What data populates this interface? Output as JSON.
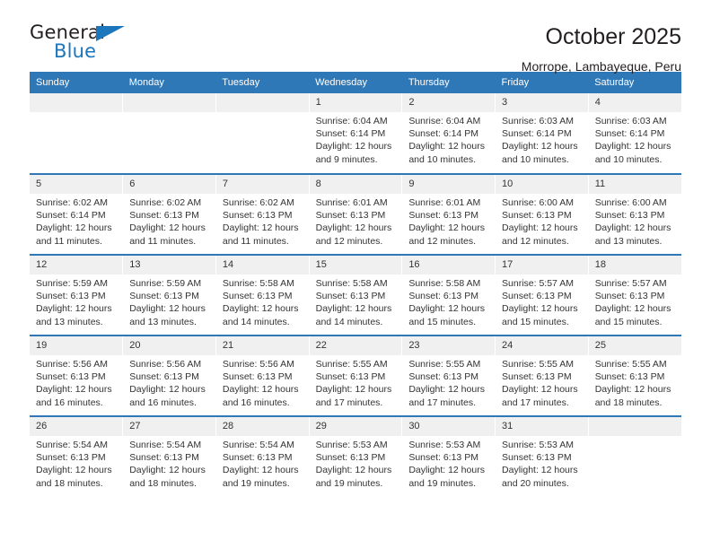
{
  "brand": {
    "name_top": "General",
    "name_bottom": "Blue"
  },
  "header": {
    "title": "October 2025",
    "subtitle": "Morrope, Lambayeque, Peru"
  },
  "colors": {
    "header_blue": "#2e78b8",
    "brand_blue": "#1b76bc",
    "daynum_band": "#f0f0f0",
    "text": "#333333"
  },
  "weekday_headers": [
    "Sunday",
    "Monday",
    "Tuesday",
    "Wednesday",
    "Thursday",
    "Friday",
    "Saturday"
  ],
  "labels": {
    "sunrise": "Sunrise:",
    "sunset": "Sunset:",
    "daylight": "Daylight:"
  },
  "weeks": [
    [
      {
        "day": "",
        "empty": true
      },
      {
        "day": "",
        "empty": true
      },
      {
        "day": "",
        "empty": true
      },
      {
        "day": "1",
        "sunrise": "Sunrise: 6:04 AM",
        "sunset": "Sunset: 6:14 PM",
        "daylight": "Daylight: 12 hours and 9 minutes."
      },
      {
        "day": "2",
        "sunrise": "Sunrise: 6:04 AM",
        "sunset": "Sunset: 6:14 PM",
        "daylight": "Daylight: 12 hours and 10 minutes."
      },
      {
        "day": "3",
        "sunrise": "Sunrise: 6:03 AM",
        "sunset": "Sunset: 6:14 PM",
        "daylight": "Daylight: 12 hours and 10 minutes."
      },
      {
        "day": "4",
        "sunrise": "Sunrise: 6:03 AM",
        "sunset": "Sunset: 6:14 PM",
        "daylight": "Daylight: 12 hours and 10 minutes."
      }
    ],
    [
      {
        "day": "5",
        "sunrise": "Sunrise: 6:02 AM",
        "sunset": "Sunset: 6:14 PM",
        "daylight": "Daylight: 12 hours and 11 minutes."
      },
      {
        "day": "6",
        "sunrise": "Sunrise: 6:02 AM",
        "sunset": "Sunset: 6:13 PM",
        "daylight": "Daylight: 12 hours and 11 minutes."
      },
      {
        "day": "7",
        "sunrise": "Sunrise: 6:02 AM",
        "sunset": "Sunset: 6:13 PM",
        "daylight": "Daylight: 12 hours and 11 minutes."
      },
      {
        "day": "8",
        "sunrise": "Sunrise: 6:01 AM",
        "sunset": "Sunset: 6:13 PM",
        "daylight": "Daylight: 12 hours and 12 minutes."
      },
      {
        "day": "9",
        "sunrise": "Sunrise: 6:01 AM",
        "sunset": "Sunset: 6:13 PM",
        "daylight": "Daylight: 12 hours and 12 minutes."
      },
      {
        "day": "10",
        "sunrise": "Sunrise: 6:00 AM",
        "sunset": "Sunset: 6:13 PM",
        "daylight": "Daylight: 12 hours and 12 minutes."
      },
      {
        "day": "11",
        "sunrise": "Sunrise: 6:00 AM",
        "sunset": "Sunset: 6:13 PM",
        "daylight": "Daylight: 12 hours and 13 minutes."
      }
    ],
    [
      {
        "day": "12",
        "sunrise": "Sunrise: 5:59 AM",
        "sunset": "Sunset: 6:13 PM",
        "daylight": "Daylight: 12 hours and 13 minutes."
      },
      {
        "day": "13",
        "sunrise": "Sunrise: 5:59 AM",
        "sunset": "Sunset: 6:13 PM",
        "daylight": "Daylight: 12 hours and 13 minutes."
      },
      {
        "day": "14",
        "sunrise": "Sunrise: 5:58 AM",
        "sunset": "Sunset: 6:13 PM",
        "daylight": "Daylight: 12 hours and 14 minutes."
      },
      {
        "day": "15",
        "sunrise": "Sunrise: 5:58 AM",
        "sunset": "Sunset: 6:13 PM",
        "daylight": "Daylight: 12 hours and 14 minutes."
      },
      {
        "day": "16",
        "sunrise": "Sunrise: 5:58 AM",
        "sunset": "Sunset: 6:13 PM",
        "daylight": "Daylight: 12 hours and 15 minutes."
      },
      {
        "day": "17",
        "sunrise": "Sunrise: 5:57 AM",
        "sunset": "Sunset: 6:13 PM",
        "daylight": "Daylight: 12 hours and 15 minutes."
      },
      {
        "day": "18",
        "sunrise": "Sunrise: 5:57 AM",
        "sunset": "Sunset: 6:13 PM",
        "daylight": "Daylight: 12 hours and 15 minutes."
      }
    ],
    [
      {
        "day": "19",
        "sunrise": "Sunrise: 5:56 AM",
        "sunset": "Sunset: 6:13 PM",
        "daylight": "Daylight: 12 hours and 16 minutes."
      },
      {
        "day": "20",
        "sunrise": "Sunrise: 5:56 AM",
        "sunset": "Sunset: 6:13 PM",
        "daylight": "Daylight: 12 hours and 16 minutes."
      },
      {
        "day": "21",
        "sunrise": "Sunrise: 5:56 AM",
        "sunset": "Sunset: 6:13 PM",
        "daylight": "Daylight: 12 hours and 16 minutes."
      },
      {
        "day": "22",
        "sunrise": "Sunrise: 5:55 AM",
        "sunset": "Sunset: 6:13 PM",
        "daylight": "Daylight: 12 hours and 17 minutes."
      },
      {
        "day": "23",
        "sunrise": "Sunrise: 5:55 AM",
        "sunset": "Sunset: 6:13 PM",
        "daylight": "Daylight: 12 hours and 17 minutes."
      },
      {
        "day": "24",
        "sunrise": "Sunrise: 5:55 AM",
        "sunset": "Sunset: 6:13 PM",
        "daylight": "Daylight: 12 hours and 17 minutes."
      },
      {
        "day": "25",
        "sunrise": "Sunrise: 5:55 AM",
        "sunset": "Sunset: 6:13 PM",
        "daylight": "Daylight: 12 hours and 18 minutes."
      }
    ],
    [
      {
        "day": "26",
        "sunrise": "Sunrise: 5:54 AM",
        "sunset": "Sunset: 6:13 PM",
        "daylight": "Daylight: 12 hours and 18 minutes."
      },
      {
        "day": "27",
        "sunrise": "Sunrise: 5:54 AM",
        "sunset": "Sunset: 6:13 PM",
        "daylight": "Daylight: 12 hours and 18 minutes."
      },
      {
        "day": "28",
        "sunrise": "Sunrise: 5:54 AM",
        "sunset": "Sunset: 6:13 PM",
        "daylight": "Daylight: 12 hours and 19 minutes."
      },
      {
        "day": "29",
        "sunrise": "Sunrise: 5:53 AM",
        "sunset": "Sunset: 6:13 PM",
        "daylight": "Daylight: 12 hours and 19 minutes."
      },
      {
        "day": "30",
        "sunrise": "Sunrise: 5:53 AM",
        "sunset": "Sunset: 6:13 PM",
        "daylight": "Daylight: 12 hours and 19 minutes."
      },
      {
        "day": "31",
        "sunrise": "Sunrise: 5:53 AM",
        "sunset": "Sunset: 6:13 PM",
        "daylight": "Daylight: 12 hours and 20 minutes."
      },
      {
        "day": "",
        "empty": true
      }
    ]
  ]
}
